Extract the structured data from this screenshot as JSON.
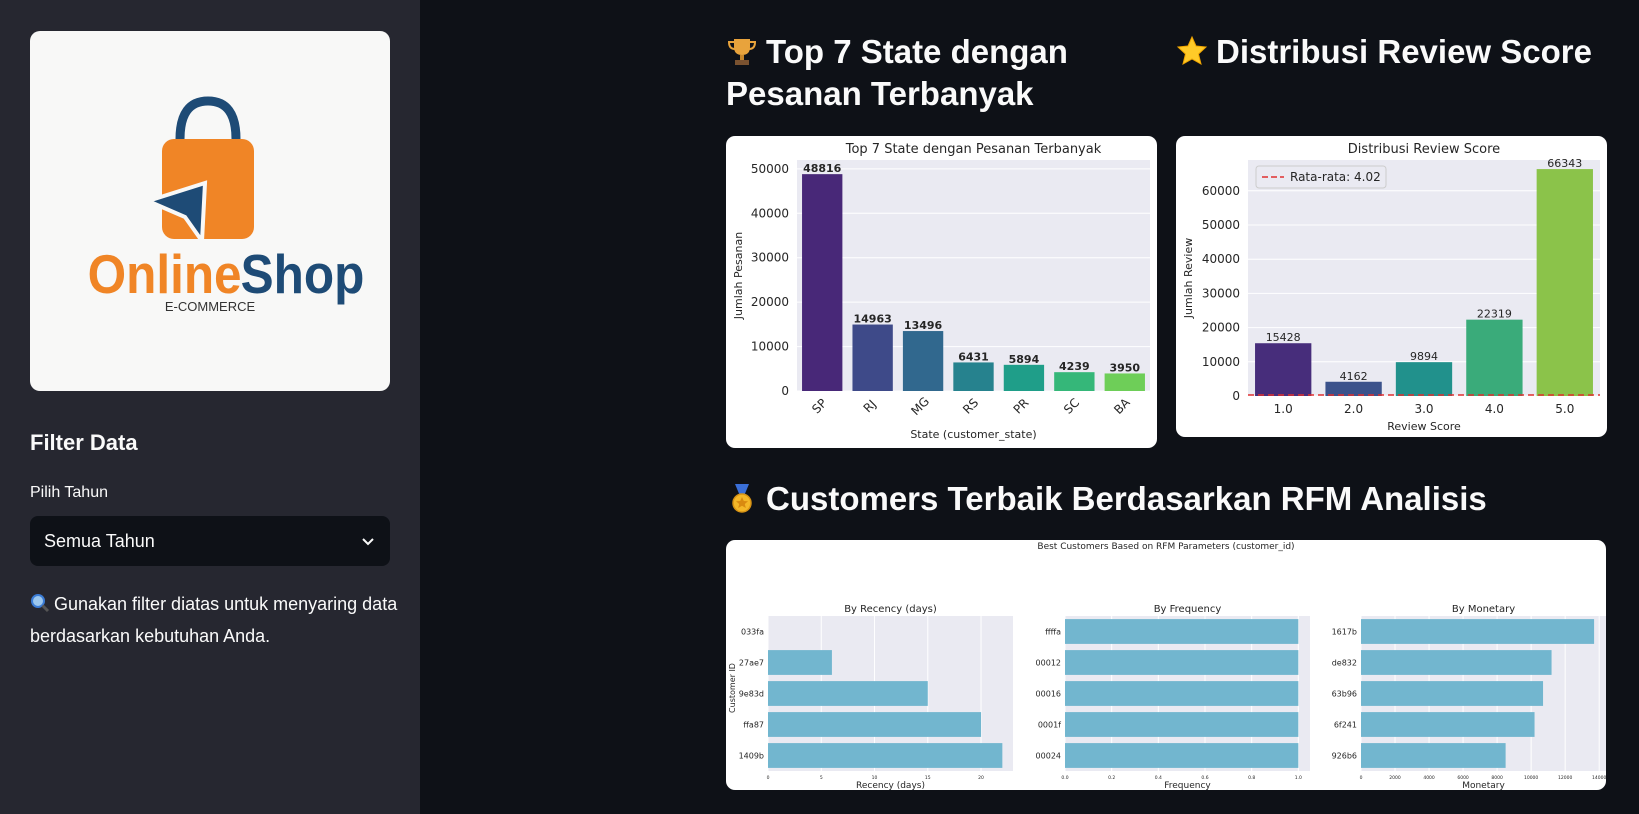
{
  "sidebar": {
    "logo": {
      "brand_word_1": "Online",
      "brand_word_2": "Shop",
      "tagline": "E-COMMERCE",
      "icon": "shopping-bag-cursor-logo"
    },
    "filter_title": "Filter Data",
    "year_label": "Pilih Tahun",
    "year_selected": "Semua Tahun",
    "hint_icon": "magnifier-icon",
    "hint_text": "Gunakan filter diatas untuk menyaring data berdasarkan kebutuhan Anda."
  },
  "sections": {
    "top_states": {
      "heading_icon": "trophy-icon",
      "heading": "Top 7 State dengan Pesanan Terbanyak"
    },
    "review": {
      "heading_icon": "star-icon",
      "heading": "Distribusi Review Score"
    },
    "rfm": {
      "heading_icon": "medal-icon",
      "heading": "Customers Terbaik Berdasarkan RFM Analisis"
    }
  },
  "colors": {
    "app_bg": "#0e1117",
    "sidebar_bg": "#262730",
    "plot_bg": "#eaeaf2",
    "rfm_bar": "#72b6cf",
    "logo_orange": "#f08526",
    "logo_navy": "#1e4b76"
  },
  "chart_data": [
    {
      "type": "bar",
      "title": "Top 7 State dengan Pesanan Terbanyak",
      "xlabel": "State (customer_state)",
      "ylabel": "Jumlah Pesanan",
      "categories": [
        "SP",
        "RJ",
        "MG",
        "RS",
        "PR",
        "SC",
        "BA"
      ],
      "values": [
        48816,
        14963,
        13496,
        6431,
        5894,
        4239,
        3950
      ],
      "data_labels": [
        "48816",
        "14963",
        "13496",
        "6431",
        "5894",
        "4239",
        "3950"
      ],
      "yticks": [
        "0",
        "10000",
        "20000",
        "30000",
        "40000",
        "50000"
      ],
      "ylim": [
        0,
        52000
      ],
      "bar_colors": [
        "#482878",
        "#3e4a89",
        "#31688e",
        "#26828e",
        "#1f9e89",
        "#35b779",
        "#6ece58",
        "#b5de2b"
      ],
      "grid": true
    },
    {
      "type": "bar",
      "title": "Distribusi Review Score",
      "xlabel": "Review Score",
      "ylabel": "Jumlah Review",
      "categories": [
        "1.0",
        "2.0",
        "3.0",
        "4.0",
        "5.0"
      ],
      "values": [
        15428,
        4162,
        9894,
        22319,
        66343
      ],
      "data_labels": [
        "15428",
        "4162",
        "9894",
        "22319",
        "66343"
      ],
      "yticks": [
        "0",
        "10000",
        "20000",
        "30000",
        "40000",
        "50000",
        "60000"
      ],
      "ylim": [
        0,
        69000
      ],
      "bar_colors": [
        "#472d7b",
        "#3b528b",
        "#21918c",
        "#3aab7a",
        "#8bc34a"
      ],
      "mean_line": {
        "value": 4.02,
        "label": "Rata-rata: 4.02",
        "color": "#e03030"
      },
      "legend": "top-left",
      "grid": true
    },
    {
      "type": "bar",
      "title": "Best Customers Based on RFM Parameters (customer_id)",
      "ylabel": "Customer ID",
      "subplots": [
        {
          "title": "By Recency (days)",
          "xlabel": "Recency (days)",
          "categories": [
            "033fa",
            "27ae7",
            "9e83d",
            "ffa87",
            "1409b"
          ],
          "values": [
            0,
            6,
            15,
            20,
            22
          ],
          "xticks": [
            "0",
            "5",
            "10",
            "15",
            "20"
          ],
          "xlim": [
            0,
            23
          ]
        },
        {
          "title": "By Frequency",
          "xlabel": "Frequency",
          "categories": [
            "ffffa",
            "00012",
            "00016",
            "0001f",
            "00024"
          ],
          "values": [
            1,
            1,
            1,
            1,
            1
          ],
          "xticks": [
            "0.0",
            "0.2",
            "0.4",
            "0.6",
            "0.8",
            "1.0"
          ],
          "xlim": [
            0,
            1.05
          ]
        },
        {
          "title": "By Monetary",
          "xlabel": "Monetary",
          "categories": [
            "1617b",
            "de832",
            "63b96",
            "6f241",
            "926b6"
          ],
          "values": [
            13700,
            11200,
            10700,
            10200,
            8500
          ],
          "xticks": [
            "0",
            "2000",
            "4000",
            "6000",
            "8000",
            "10000",
            "12000",
            "14000"
          ],
          "xlim": [
            0,
            14400
          ]
        }
      ]
    }
  ]
}
